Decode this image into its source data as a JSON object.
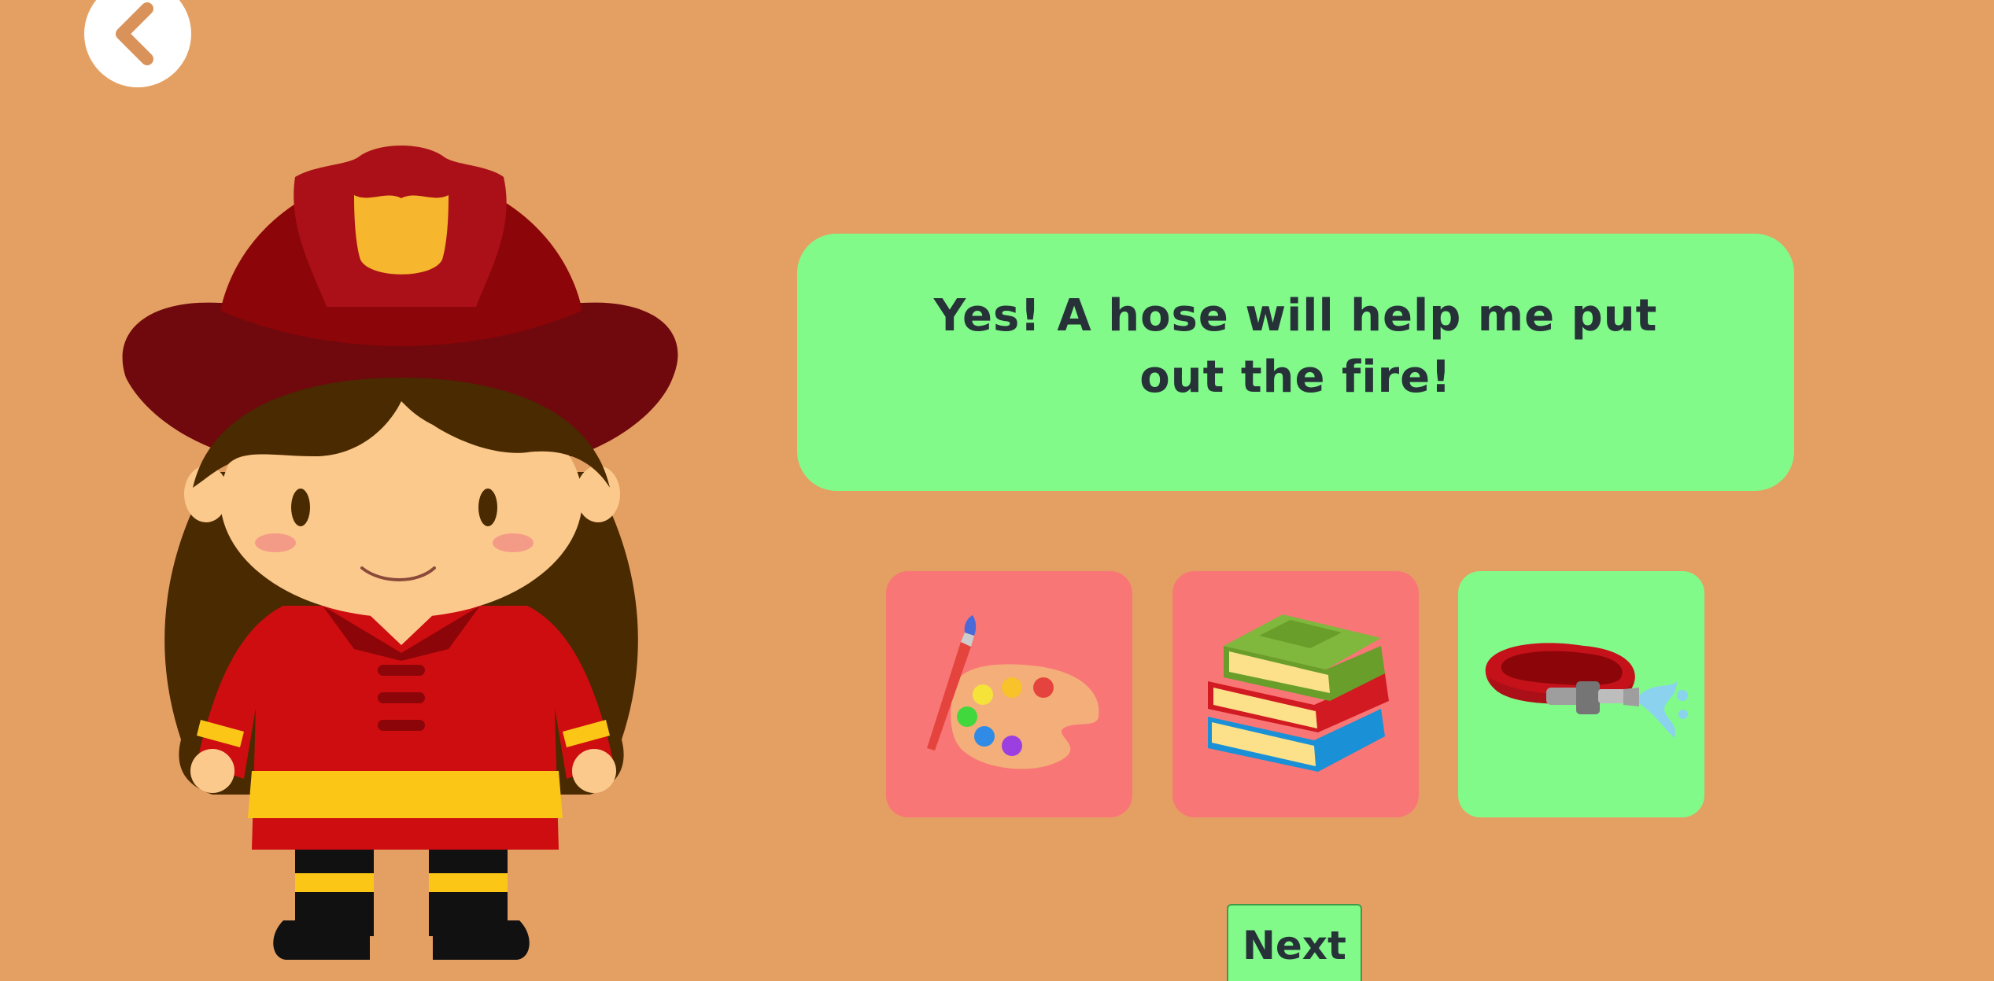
{
  "colors": {
    "background": "#e4a063",
    "bubble": "#81fa8a",
    "card_wrong": "#f97676",
    "card_correct": "#81fa8a",
    "next_button": "#81fa8a",
    "back_button": "#ffffff",
    "back_arrow": "#d9925a"
  },
  "back_button": {
    "icon": "chevron-left-icon"
  },
  "character": {
    "icon": "firefighter-girl-illustration"
  },
  "speech": {
    "text": "Yes! A hose will help me put out the fire!"
  },
  "choices": [
    {
      "icon": "paint-palette-icon",
      "state": "wrong"
    },
    {
      "icon": "books-stack-icon",
      "state": "wrong"
    },
    {
      "icon": "fire-hose-icon",
      "state": "correct"
    }
  ],
  "next_button": {
    "label": "Next"
  }
}
